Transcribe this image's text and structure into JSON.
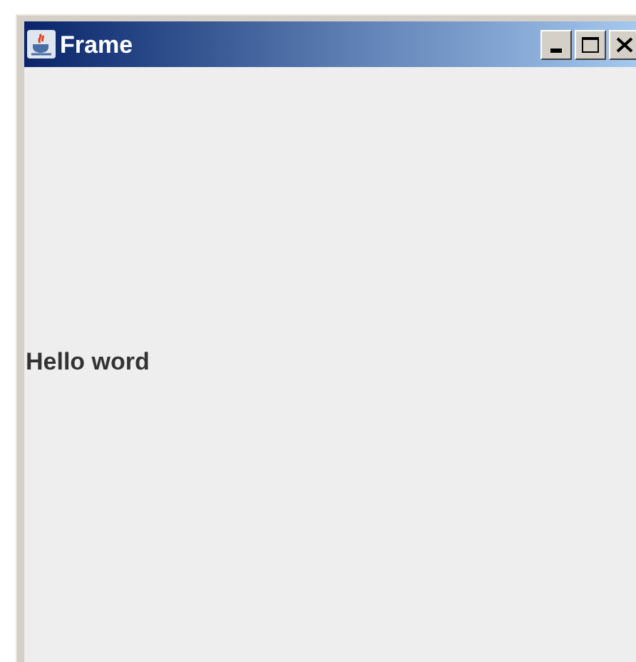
{
  "window": {
    "title": "Frame"
  },
  "content": {
    "label": "Hello word"
  }
}
